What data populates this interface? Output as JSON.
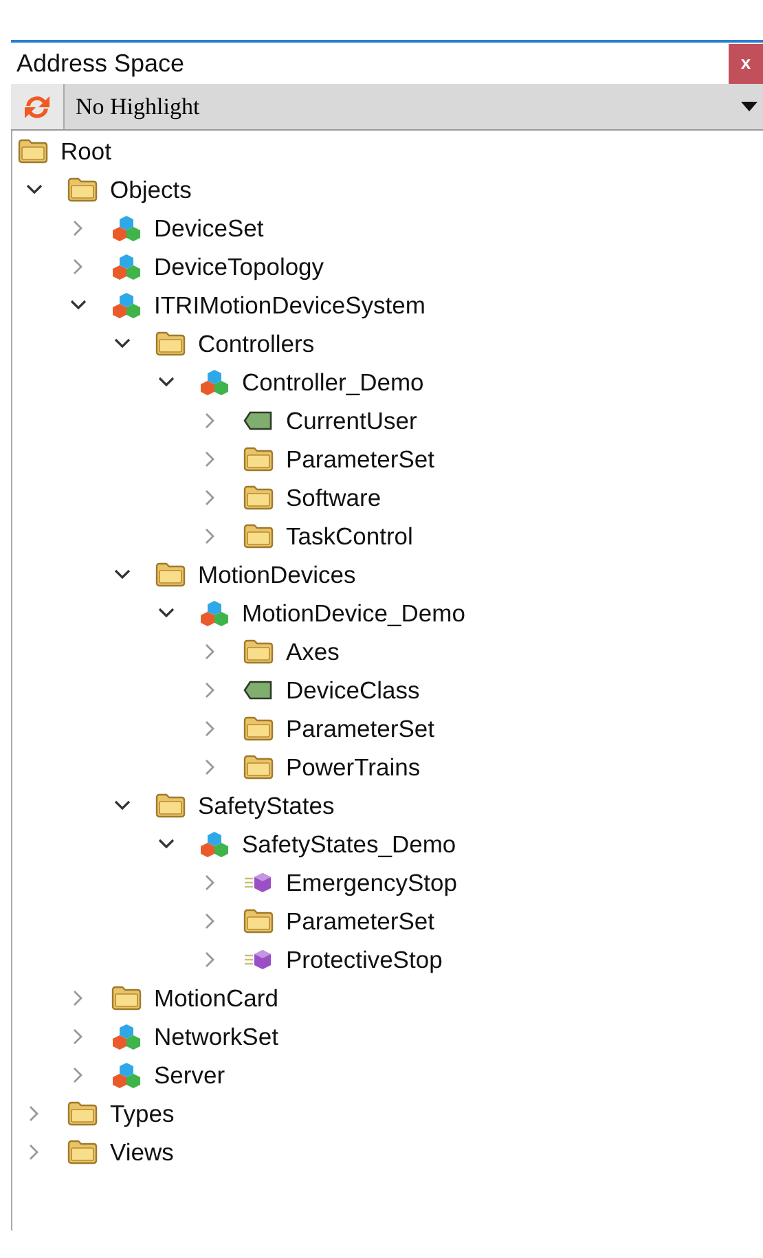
{
  "panel": {
    "title": "Address Space",
    "close": "x"
  },
  "toolbar": {
    "highlight": "No Highlight"
  },
  "tree": [
    {
      "label": "Root",
      "kind": "folder",
      "children": [
        {
          "label": "Objects",
          "kind": "folder",
          "expanded": true,
          "children": [
            {
              "label": "DeviceSet",
              "kind": "object",
              "expanded": false
            },
            {
              "label": "DeviceTopology",
              "kind": "object",
              "expanded": false
            },
            {
              "label": "ITRIMotionDeviceSystem",
              "kind": "object",
              "expanded": true,
              "children": [
                {
                  "label": "Controllers",
                  "kind": "folder",
                  "expanded": true,
                  "children": [
                    {
                      "label": "Controller_Demo",
                      "kind": "object",
                      "expanded": true,
                      "children": [
                        {
                          "label": "CurrentUser",
                          "kind": "variable",
                          "expanded": false
                        },
                        {
                          "label": "ParameterSet",
                          "kind": "folder",
                          "expanded": false
                        },
                        {
                          "label": "Software",
                          "kind": "folder",
                          "expanded": false
                        },
                        {
                          "label": "TaskControl",
                          "kind": "folder",
                          "expanded": false
                        }
                      ]
                    }
                  ]
                },
                {
                  "label": "MotionDevices",
                  "kind": "folder",
                  "expanded": true,
                  "children": [
                    {
                      "label": "MotionDevice_Demo",
                      "kind": "object",
                      "expanded": true,
                      "children": [
                        {
                          "label": "Axes",
                          "kind": "folder",
                          "expanded": false
                        },
                        {
                          "label": "DeviceClass",
                          "kind": "variable",
                          "expanded": false
                        },
                        {
                          "label": "ParameterSet",
                          "kind": "folder",
                          "expanded": false
                        },
                        {
                          "label": "PowerTrains",
                          "kind": "folder",
                          "expanded": false
                        }
                      ]
                    }
                  ]
                },
                {
                  "label": "SafetyStates",
                  "kind": "folder",
                  "expanded": true,
                  "children": [
                    {
                      "label": "SafetyStates_Demo",
                      "kind": "object",
                      "expanded": true,
                      "children": [
                        {
                          "label": "EmergencyStop",
                          "kind": "method",
                          "expanded": false
                        },
                        {
                          "label": "ParameterSet",
                          "kind": "folder",
                          "expanded": false
                        },
                        {
                          "label": "ProtectiveStop",
                          "kind": "method",
                          "expanded": false
                        }
                      ]
                    }
                  ]
                }
              ]
            },
            {
              "label": "MotionCard",
              "kind": "folder",
              "expanded": false
            },
            {
              "label": "NetworkSet",
              "kind": "object",
              "expanded": false
            },
            {
              "label": "Server",
              "kind": "object",
              "expanded": false
            }
          ]
        },
        {
          "label": "Types",
          "kind": "folder",
          "expanded": false
        },
        {
          "label": "Views",
          "kind": "folder",
          "expanded": false
        }
      ]
    }
  ]
}
